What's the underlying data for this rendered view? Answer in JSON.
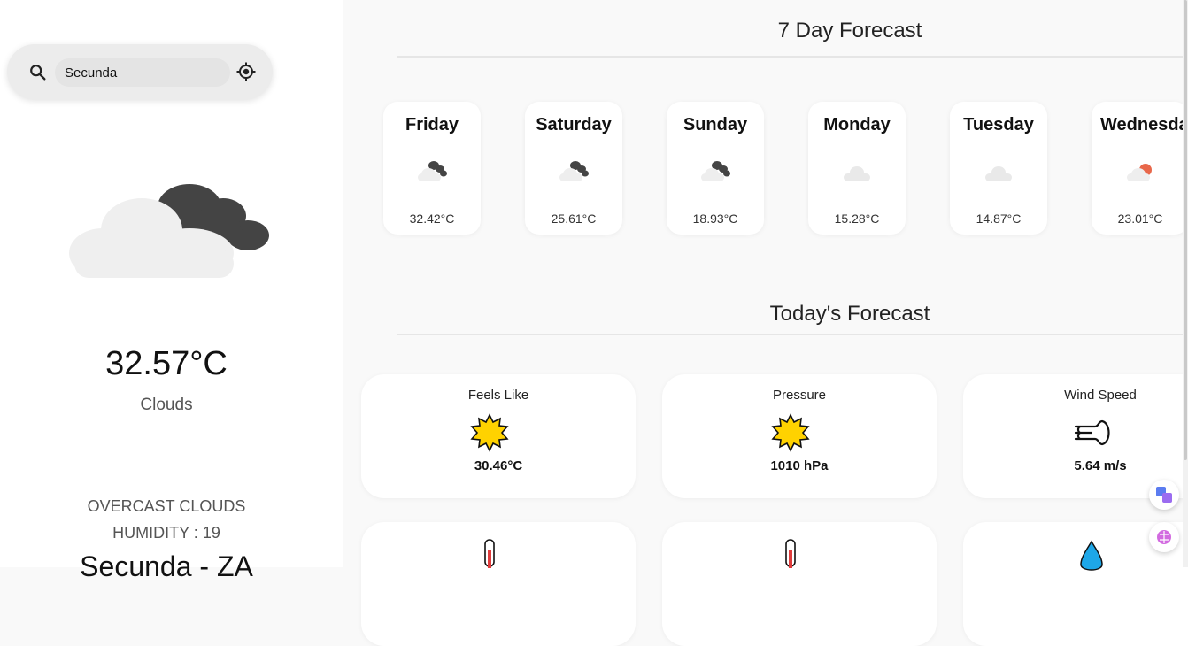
{
  "search": {
    "value": "Secunda"
  },
  "current": {
    "temperature": "32.57°C",
    "condition": "Clouds",
    "description": "OVERCAST CLOUDS",
    "humidity": "HUMIDITY : 19",
    "location": "Secunda - ZA"
  },
  "weekly": {
    "title": "7 Day Forecast",
    "days": [
      {
        "name": "Friday",
        "temp": "32.42°C",
        "icon": "broken-clouds-icon"
      },
      {
        "name": "Saturday",
        "temp": "25.61°C",
        "icon": "broken-clouds-icon"
      },
      {
        "name": "Sunday",
        "temp": "18.93°C",
        "icon": "broken-clouds-icon"
      },
      {
        "name": "Monday",
        "temp": "15.28°C",
        "icon": "cloud-icon"
      },
      {
        "name": "Tuesday",
        "temp": "14.87°C",
        "icon": "cloud-icon"
      },
      {
        "name": "Wednesday",
        "temp": "23.01°C",
        "icon": "sun-behind-cloud-icon"
      }
    ]
  },
  "today": {
    "title": "Today's Forecast",
    "cards": [
      {
        "label": "Feels Like",
        "value": "30.46°C",
        "icon": "sun-icon"
      },
      {
        "label": "Pressure",
        "value": "1010 hPa",
        "icon": "sun-icon"
      },
      {
        "label": "Wind Speed",
        "value": "5.64 m/s",
        "icon": "wind-icon"
      }
    ],
    "lower_icons": [
      "thermometer-icon",
      "thermometer-icon",
      "droplet-icon"
    ]
  },
  "colors": {
    "accent_sun": "#ffd200",
    "cloud_dark": "#444444",
    "cloud_light": "#eeeeee",
    "sun_red": "#e8674a"
  }
}
